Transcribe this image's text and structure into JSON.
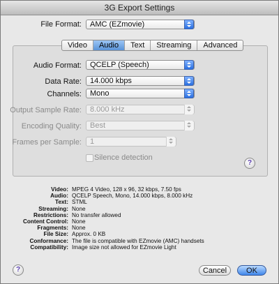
{
  "window": {
    "title": "3G Export Settings"
  },
  "file_format": {
    "label": "File Format:",
    "value": "AMC (EZmovie)"
  },
  "tabs": [
    "Video",
    "Audio",
    "Text",
    "Streaming",
    "Advanced"
  ],
  "selected_tab": "Audio",
  "audio": {
    "format": {
      "label": "Audio Format:",
      "value": "QCELP (Speech)"
    },
    "data_rate": {
      "label": "Data Rate:",
      "value": "14.000 kbps"
    },
    "channels": {
      "label": "Channels:",
      "value": "Mono"
    },
    "sample_rate": {
      "label": "Output Sample Rate:",
      "value": "8.000 kHz"
    },
    "quality": {
      "label": "Encoding Quality:",
      "value": "Best"
    },
    "frames": {
      "label": "Frames per Sample:",
      "value": "1"
    },
    "silence": {
      "label": "Silence detection"
    }
  },
  "summary": [
    {
      "key": "Video:",
      "value": "MPEG 4 Video, 128 x 96, 32 kbps, 7.50 fps"
    },
    {
      "key": "Audio:",
      "value": "QCELP Speech, Mono, 14.000 kbps, 8.000 kHz"
    },
    {
      "key": "Text:",
      "value": "STML"
    },
    {
      "key": "Streaming:",
      "value": "None"
    },
    {
      "key": "Restrictions:",
      "value": "No transfer allowed"
    },
    {
      "key": "Content Control:",
      "value": "None"
    },
    {
      "key": "Fragments:",
      "value": "None"
    },
    {
      "key": "File Size:",
      "value": "Approx. 0 KB"
    },
    {
      "key": "Conformance:",
      "value": "The file is compatible with EZmovie (AMC) handsets"
    },
    {
      "key": "Compatibility:",
      "value": "Image size not allowed for EZmovie Light"
    }
  ],
  "help_glyph": "?",
  "buttons": {
    "cancel": "Cancel",
    "ok": "OK"
  },
  "colors": {
    "accent": "#3f86ea",
    "help": "#5b3fb0"
  }
}
